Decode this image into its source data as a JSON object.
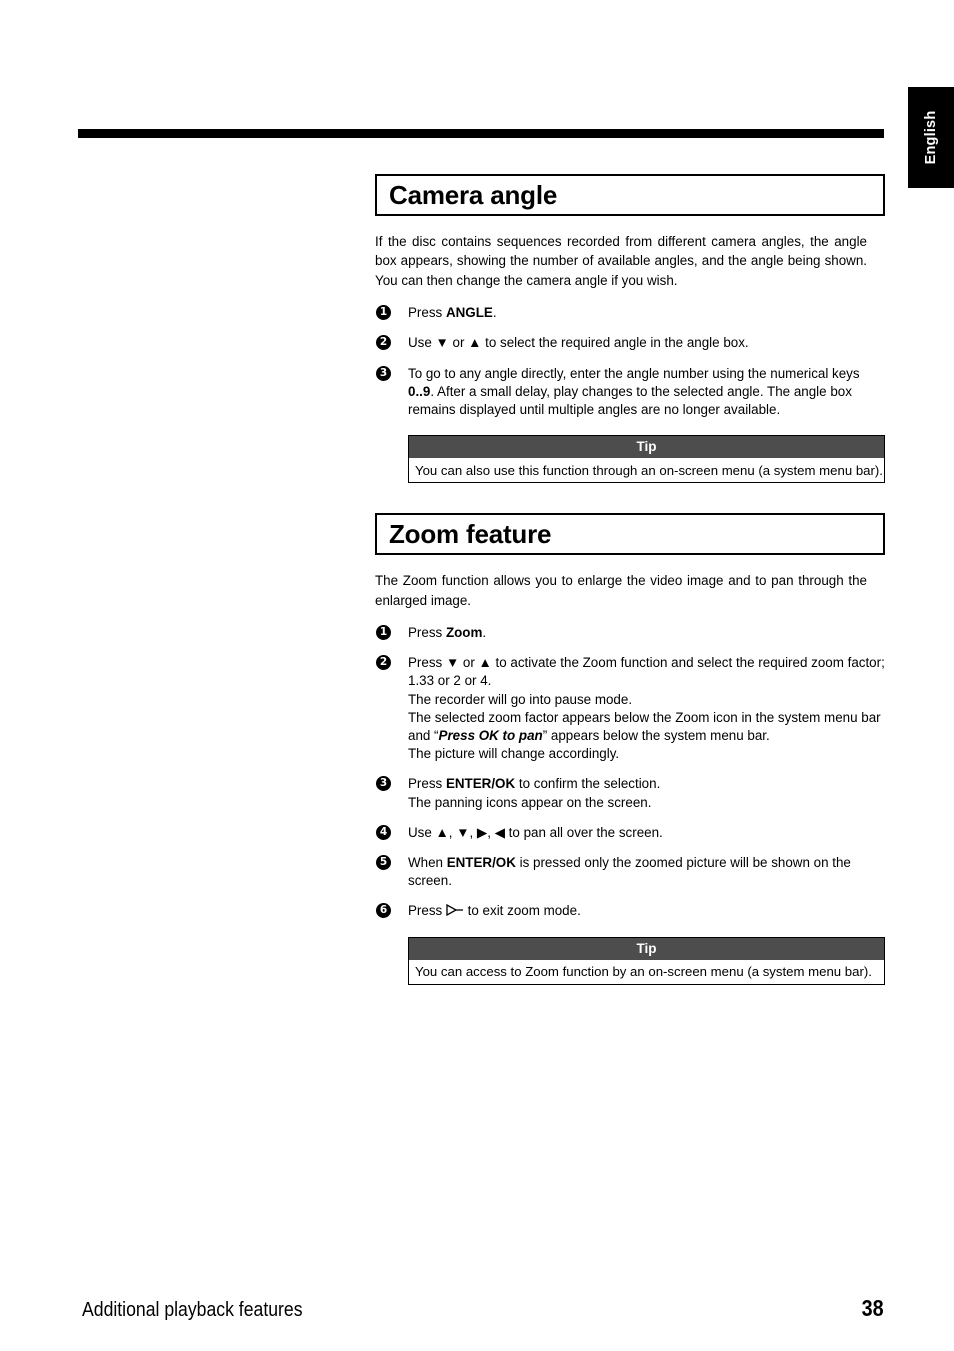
{
  "page": {
    "language_tab": "English",
    "footer_title": "Additional playback features",
    "page_number": "38",
    "rule_color": "#000000",
    "tip_header_color": "#4d4d4d"
  },
  "sections": [
    {
      "heading": "Camera angle",
      "intro": "If the disc contains sequences recorded from different camera angles, the angle box appears, showing the number of available angles, and the angle being shown. You can then change the camera angle if you wish.",
      "steps": [
        {
          "num": "1",
          "pre": "Press ",
          "strong": "ANGLE",
          "post": "."
        },
        {
          "num": "2",
          "line1": "Use ▼ or ▲ to select the required angle in the angle box."
        },
        {
          "num": "3",
          "pre": "To go to any angle directly, enter the angle number using the numerical keys ",
          "strong": "0..9",
          "post": ". After a small delay, play changes to the selected angle. The angle box remains displayed until multiple angles are no longer available."
        }
      ],
      "tip": {
        "header": "Tip",
        "body": "You can also use this function through an on-screen menu (a system menu bar)."
      }
    },
    {
      "heading": "Zoom feature",
      "intro": "The Zoom function allows you to enlarge the video image and to pan through the enlarged image.",
      "steps": [
        {
          "num": "1",
          "pre": "Press ",
          "strong": "Zoom",
          "post": "."
        },
        {
          "num": "2",
          "line1": "Press ▼ or ▲ to activate the Zoom function and select the required zoom factor; 1.33 or 2 or 4.",
          "line2": "The recorder will go into pause mode.",
          "line3a": "The selected zoom factor appears below the Zoom icon in the system menu bar and “",
          "line3_em": "Press OK to pan",
          "line3b": "” appears below the system menu bar.",
          "line4": "The picture will change accordingly."
        },
        {
          "num": "3",
          "pre": "Press ",
          "strong": "ENTER/OK",
          "post": " to confirm the selection.",
          "line2": "The panning icons appear on the screen."
        },
        {
          "num": "4",
          "line1": "Use ▲, ▼, ▶, ◀ to pan all over the screen."
        },
        {
          "num": "5",
          "pre": "When ",
          "strong": "ENTER/OK",
          "post": " is pressed only the zoomed picture will be shown on the screen."
        },
        {
          "num": "6",
          "pre": "Press ",
          "icon": "play-icon",
          "post": " to exit zoom mode."
        }
      ],
      "tip": {
        "header": "Tip",
        "body": "You can access to Zoom function by an on-screen menu (a system menu bar)."
      }
    }
  ]
}
